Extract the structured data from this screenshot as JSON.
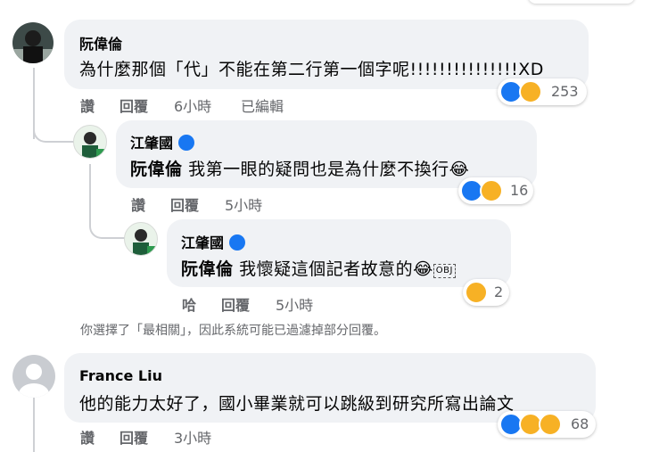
{
  "comments": [
    {
      "author": "阮偉倫",
      "text": "為什麼那個「代」不能在第二行第一個字呢!!!!!!!!!!!!!!!XD",
      "actions": {
        "like": "讚",
        "reply": "回覆",
        "time": "6小時",
        "edited": "已編輯"
      },
      "reaction_count": "253",
      "reaction_icons": [
        "like-icon",
        "haha-icon"
      ]
    },
    {
      "author": "江肇國",
      "verified": true,
      "tag": "阮偉倫",
      "text": "我第一眼的疑問也是為什麼不換行",
      "emoji": "😂",
      "actions": {
        "like": "讚",
        "reply": "回覆",
        "time": "5小時"
      },
      "reaction_count": "16",
      "reaction_icons": [
        "like-icon",
        "haha-icon"
      ]
    },
    {
      "author": "江肇國",
      "verified": true,
      "tag": "阮偉倫",
      "text": "我懷疑這個記者故意的",
      "emoji": "😂",
      "obj_glyph": "OBJ",
      "actions": {
        "like": "哈",
        "reply": "回覆",
        "time": "5小時"
      },
      "reaction_count": "2",
      "reaction_icons": [
        "haha-icon"
      ]
    },
    {
      "author": "France Liu",
      "text": "他的能力太好了，國小畢業就可以跳級到研究所寫出論文",
      "actions": {
        "like": "讚",
        "reply": "回覆",
        "time": "3小時"
      },
      "reaction_count": "68",
      "reaction_icons": [
        "like-icon",
        "haha-icon",
        "wow-icon"
      ]
    }
  ],
  "filter_note": "你選擇了「最相關」，因此系統可能已過濾掉部分回覆。",
  "colors": {
    "bubble": "#f0f2f5",
    "secondary_text": "#65676b",
    "like_blue": "#1877f2",
    "haha_yellow": "#f7b125",
    "thread_line": "#ced0d4"
  }
}
